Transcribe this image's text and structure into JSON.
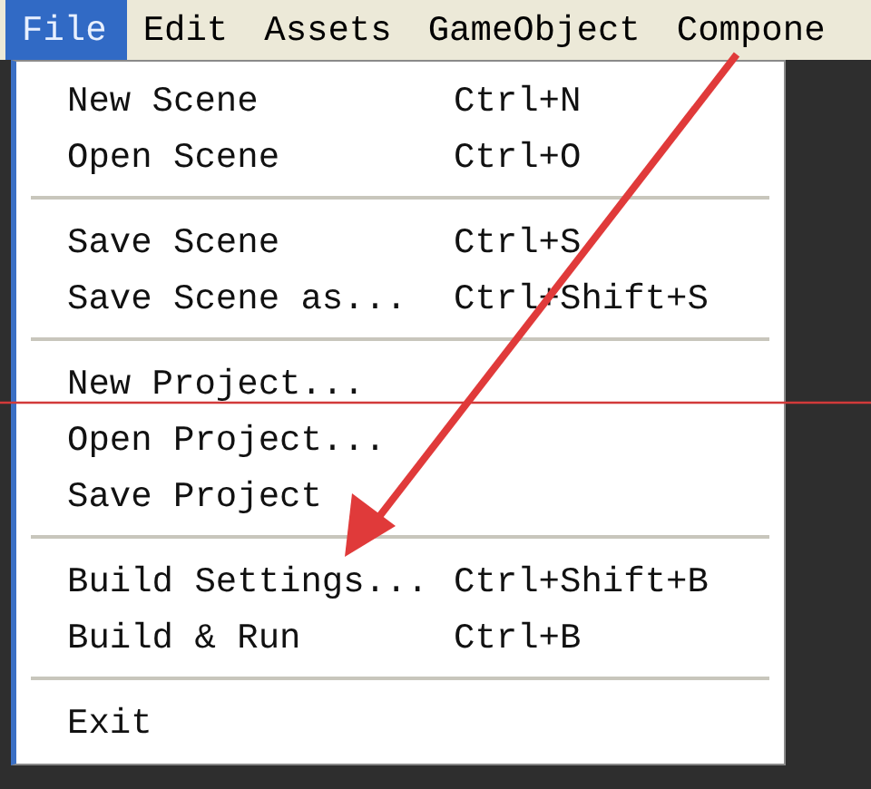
{
  "menubar": [
    {
      "label": "File",
      "selected": true
    },
    {
      "label": "Edit",
      "selected": false
    },
    {
      "label": "Assets",
      "selected": false
    },
    {
      "label": "GameObject",
      "selected": false
    },
    {
      "label": "Compone",
      "selected": false
    }
  ],
  "menu": {
    "groups": [
      {
        "items": [
          {
            "label": "New Scene",
            "shortcut": "Ctrl+N"
          },
          {
            "label": "Open Scene",
            "shortcut": "Ctrl+O"
          }
        ]
      },
      {
        "items": [
          {
            "label": "Save Scene",
            "shortcut": "Ctrl+S"
          },
          {
            "label": "Save Scene as...",
            "shortcut": "Ctrl+Shift+S"
          }
        ]
      },
      {
        "items": [
          {
            "label": "New Project..."
          },
          {
            "label": "Open Project..."
          },
          {
            "label": "Save Project"
          }
        ]
      },
      {
        "items": [
          {
            "label": "Build Settings...",
            "shortcut": "Ctrl+Shift+B"
          },
          {
            "label": "Build & Run",
            "shortcut": "Ctrl+B"
          }
        ]
      },
      {
        "items": [
          {
            "label": "Exit"
          }
        ]
      }
    ]
  }
}
